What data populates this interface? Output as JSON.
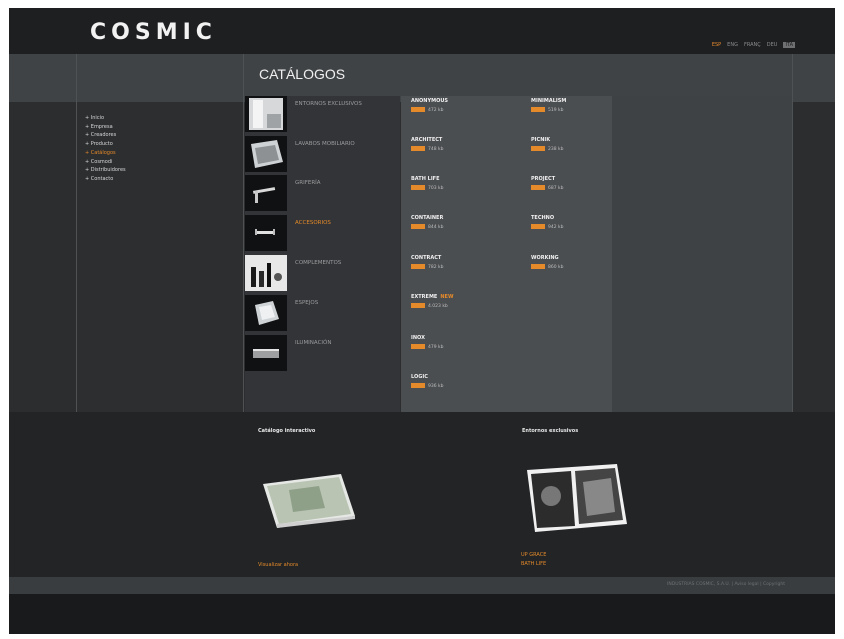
{
  "brand": {
    "logo": "COSMIC"
  },
  "lang": {
    "items": [
      "ESP",
      "ENG",
      "FRANÇ",
      "DEU",
      "ITA"
    ]
  },
  "page": {
    "title": "CATÁLOGOS"
  },
  "leftnav": {
    "items": [
      "Inicio",
      "Empresa",
      "Creadores",
      "Producto",
      "Catálogos",
      "Cosmodi",
      "Distribuidores",
      "Contacto"
    ],
    "active_index": 4
  },
  "categories": [
    {
      "label": "ENTORNOS EXCLUSIVOS",
      "active": false
    },
    {
      "label": "LAVABOS MOBILIARIO",
      "active": false
    },
    {
      "label": "GRIFERÍA",
      "active": false
    },
    {
      "label": "ACCESORIOS",
      "active": true
    },
    {
      "label": "COMPLEMENTOS",
      "active": false
    },
    {
      "label": "ESPEJOS",
      "active": false
    },
    {
      "label": "ILUMINACIÓN",
      "active": false
    }
  ],
  "products": {
    "col1": [
      {
        "name": "ANONYMOUS",
        "size": "472 kb"
      },
      {
        "name": "ARCHITECT",
        "size": "748 kb"
      },
      {
        "name": "BATH LIFE",
        "size": "703 kb"
      },
      {
        "name": "CONTAINER",
        "size": "844 kb"
      },
      {
        "name": "CONTRACT",
        "size": "782 kb"
      },
      {
        "name": "EXTREME",
        "size": "4.023 kb",
        "badge": "NEW"
      },
      {
        "name": "INOX",
        "size": "479 kb"
      },
      {
        "name": "LOGIC",
        "size": "936 kb"
      }
    ],
    "col2": [
      {
        "name": "MINIMALISM",
        "size": "519 kb"
      },
      {
        "name": "PICNIK",
        "size": "238 kb"
      },
      {
        "name": "PROJECT",
        "size": "687 kb"
      },
      {
        "name": "TECHNO",
        "size": "942 kb"
      },
      {
        "name": "WORKING",
        "size": "860 kb"
      }
    ]
  },
  "bottom": {
    "left_title": "Catálogo interactivo",
    "left_link": "Visualizar ahora",
    "right_title": "Entornos exclusivos",
    "right_links": [
      "UP GRACE",
      "BATH LIFE"
    ]
  },
  "footer": {
    "text": "INDUSTRIAS COSMIC, S.A.U.  |  Aviso legal  |  Copyright"
  },
  "colors": {
    "accent": "#e58a2a",
    "background": "#2b2d2f",
    "header": "#1e1f21"
  }
}
